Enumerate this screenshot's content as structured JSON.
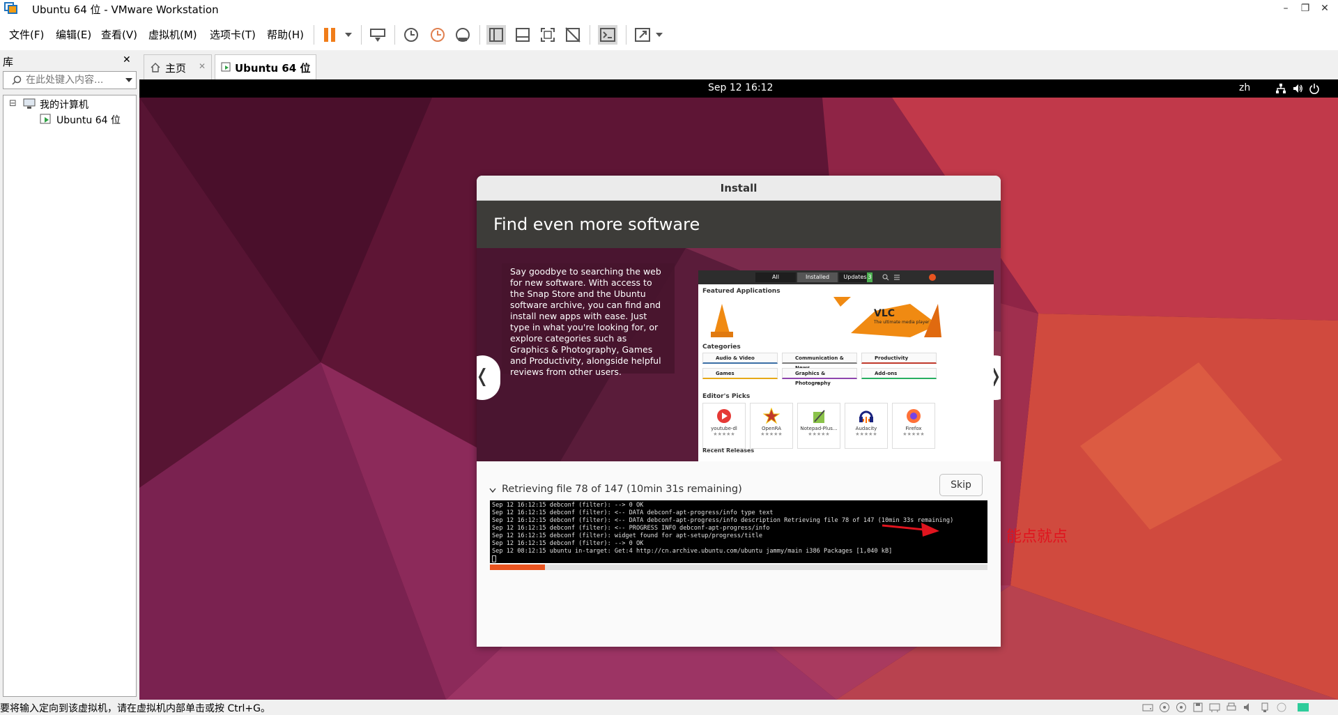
{
  "window": {
    "title": "Ubuntu 64 位 - VMware Workstation",
    "controls": {
      "minimize": "–",
      "restore": "❐",
      "close": "✕"
    }
  },
  "menu": {
    "items": [
      "文件(F)",
      "编辑(E)",
      "查看(V)",
      "虚拟机(M)",
      "选项卡(T)",
      "帮助(H)"
    ]
  },
  "library": {
    "title": "库",
    "close": "✕",
    "search_placeholder": "在此处键入内容...",
    "tree": {
      "root": "我的计算机",
      "expander": "⊟",
      "child": "Ubuntu 64 位"
    }
  },
  "tabs": [
    {
      "label": "主页",
      "close": "✕"
    },
    {
      "label": "Ubuntu 64 位",
      "close": "✕"
    }
  ],
  "guest_topbar": {
    "datetime": "Sep 12  16:12",
    "lang": "zh"
  },
  "installer": {
    "window_title": "Install",
    "heading": "Find even more software",
    "slide_text": "Say goodbye to searching the web for new software. With access to the Snap Store and the Ubuntu software archive, you can find and install new apps with ease. Just type in what you're looking for, or explore categories such as Graphics & Photography, Games and Productivity, alongside helpful reviews from other users.",
    "nav_prev": "❬",
    "nav_next": "❭",
    "store": {
      "tabs": [
        "All",
        "Installed",
        "Updates"
      ],
      "updates_badge": "3",
      "featured_title": "Featured Applications",
      "vlc_title": "VLC",
      "vlc_subtitle": "The ultimate media player",
      "categories_title": "Categories",
      "categories": [
        "Audio & Video",
        "Communication & News",
        "Productivity",
        "Games",
        "Graphics & Photography",
        "Add-ons"
      ],
      "category_colors": [
        "#3a6ea5",
        "#7a7a7a",
        "#c0392b",
        "#e6a817",
        "#8e44ad",
        "#27ae60"
      ],
      "picks_title": "Editor's Picks",
      "picks": [
        "youtube-dl",
        "OpenRA",
        "Notepad-Plus...",
        "Audacity",
        "Firefox"
      ],
      "stars": "★★★★★",
      "recent_title": "Recent Releases"
    },
    "status": "Retrieving file 78 of 147 (10min 31s remaining)",
    "skip": "Skip",
    "progress": 0.11,
    "log": [
      "Sep 12 16:12:15 debconf (filter): --> 0 OK",
      "Sep 12 16:12:15 debconf (filter): <-- DATA debconf-apt-progress/info type text",
      "Sep 12 16:12:15 debconf (filter): <-- DATA debconf-apt-progress/info description Retrieving file 78 of 147 (10min 33s remaining)",
      "Sep 12 16:12:15 debconf (filter): <-- PROGRESS INFO debconf-apt-progress/info",
      "Sep 12 16:12:15 debconf (filter): widget found for apt-setup/progress/title",
      "Sep 12 16:12:15 debconf (filter): --> 0 OK",
      "Sep 12 08:12:15 ubuntu in-target: Get:4 http://cn.archive.ubuntu.com/ubuntu jammy/main i386 Packages [1,040 kB]"
    ]
  },
  "annotation": {
    "text": "能点就点"
  },
  "statusbar": {
    "message": "要将输入定向到该虚拟机，请在虚拟机内部单击或按 Ctrl+G。"
  }
}
